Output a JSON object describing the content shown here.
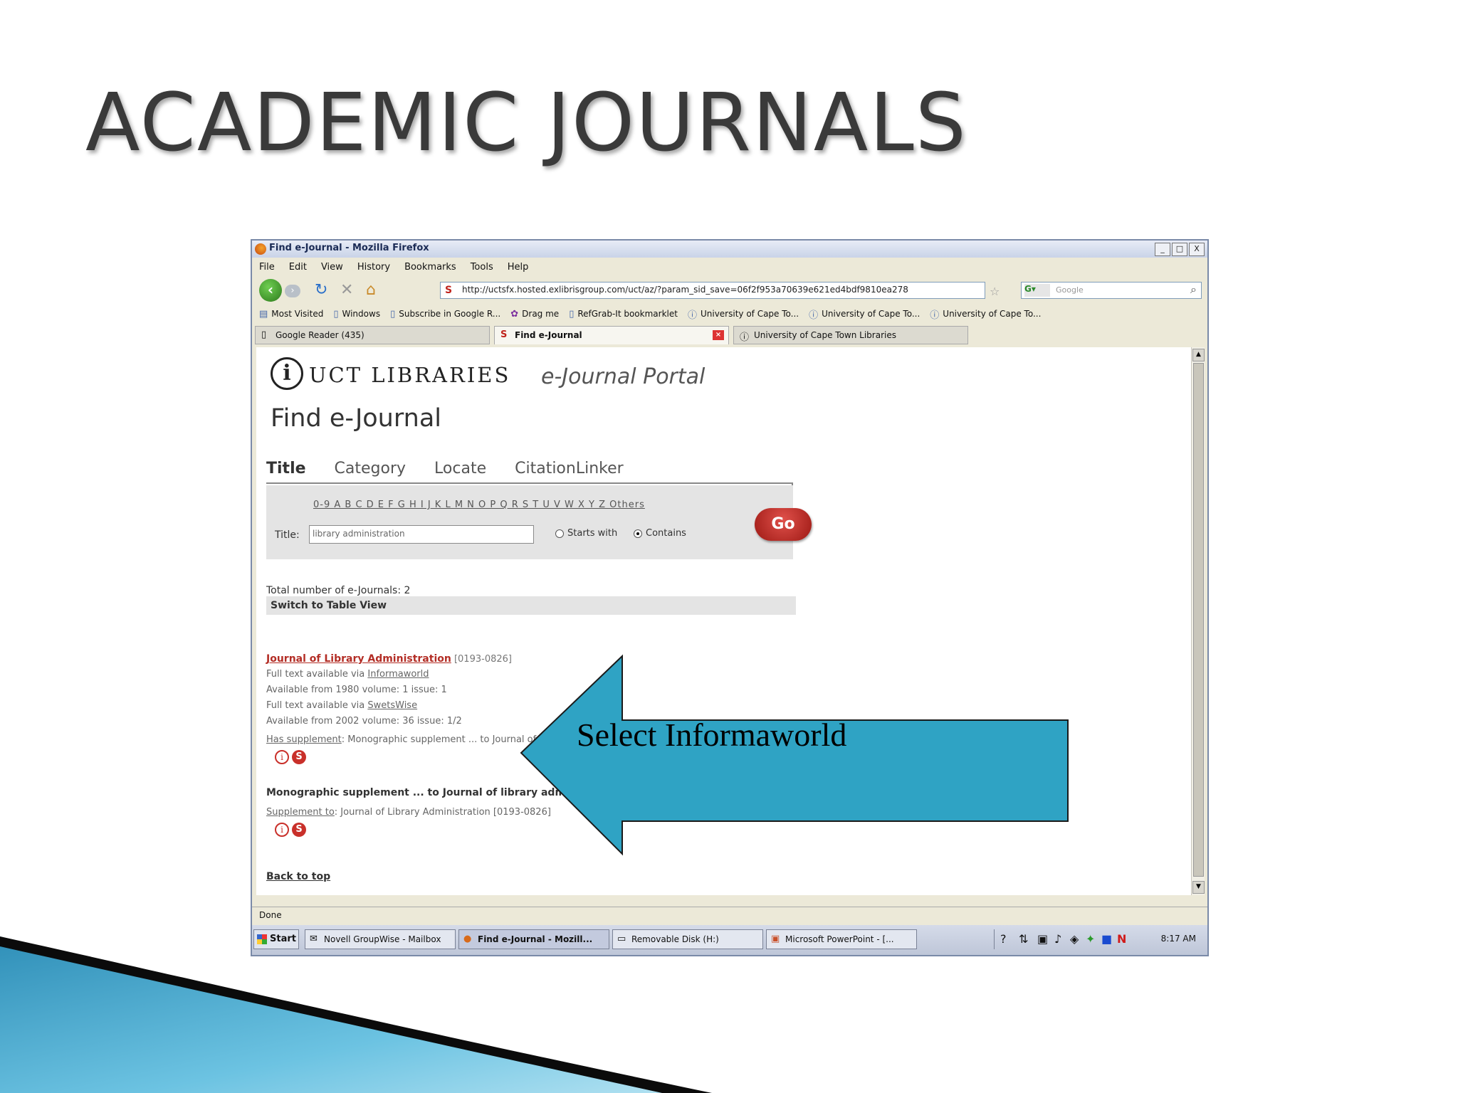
{
  "slide": {
    "title": "ACADEMIC JOURNALS"
  },
  "browser": {
    "window_title": "Find e-Journal - Mozilla Firefox",
    "window_buttons": [
      "_",
      "□",
      "X"
    ],
    "menu": [
      "File",
      "Edit",
      "View",
      "History",
      "Bookmarks",
      "Tools",
      "Help"
    ],
    "url": "http://uctsfx.hosted.exlibrisgroup.com/uct/az/?param_sid_save=06f2f953a70639e621ed4bdf9810ea278",
    "search_placeholder": "Google",
    "bookmarks": [
      "Most Visited",
      "Windows",
      "Subscribe in Google R...",
      "Drag me",
      "RefGrab-It bookmarklet",
      "University of Cape To...",
      "University of Cape To...",
      "University of Cape To..."
    ],
    "tabs": [
      "Google Reader (435)",
      "Find e-Journal",
      "University of Cape Town Libraries"
    ],
    "status": "Done"
  },
  "page": {
    "logo_text": "UCT LIBRARIES",
    "portal_label": "e-Journal Portal",
    "heading": "Find e-Journal",
    "search_tabs": [
      "Title",
      "Category",
      "Locate",
      "CitationLinker"
    ],
    "alphabet": "0-9 A B C D E F G H I J K L M N O P Q R S T U V W X Y Z Others",
    "title_label": "Title:",
    "title_value": "library administration",
    "starts_with": "Starts with",
    "contains": "Contains",
    "go_label": "Go",
    "total": "Total number of e-Journals: 2",
    "switch_view": "Switch to Table View",
    "result1": {
      "title": "Journal of Library Administration",
      "issn": "[0193-0826]",
      "line1_prefix": "Full text available via",
      "line1_link": "Informaworld",
      "line2": "Available from 1980 volume: 1 issue: 1",
      "line3_prefix": "Full text available via",
      "line3_link": "SwetsWise",
      "line4": "Available from 2002 volume: 36 issue: 1/2",
      "supplement_link": "Has supplement",
      "supplement_text": ": Monographic supplement ... to Journal of"
    },
    "result2": {
      "title": "Monographic supplement ... to Journal of library admi",
      "supplement_link": "Supplement to",
      "supplement_text": ": Journal of Library Administration [0193-0826]"
    },
    "back_to_top": "Back to top"
  },
  "taskbar": {
    "start": "Start",
    "items": [
      "Novell GroupWise - Mailbox",
      "Find e-Journal - Mozill...",
      "Removable Disk (H:)",
      "Microsoft PowerPoint - [..."
    ],
    "clock": "8:17 AM"
  },
  "callout": {
    "text": "Select Informaworld",
    "fill_color": "#2fa3c4"
  }
}
